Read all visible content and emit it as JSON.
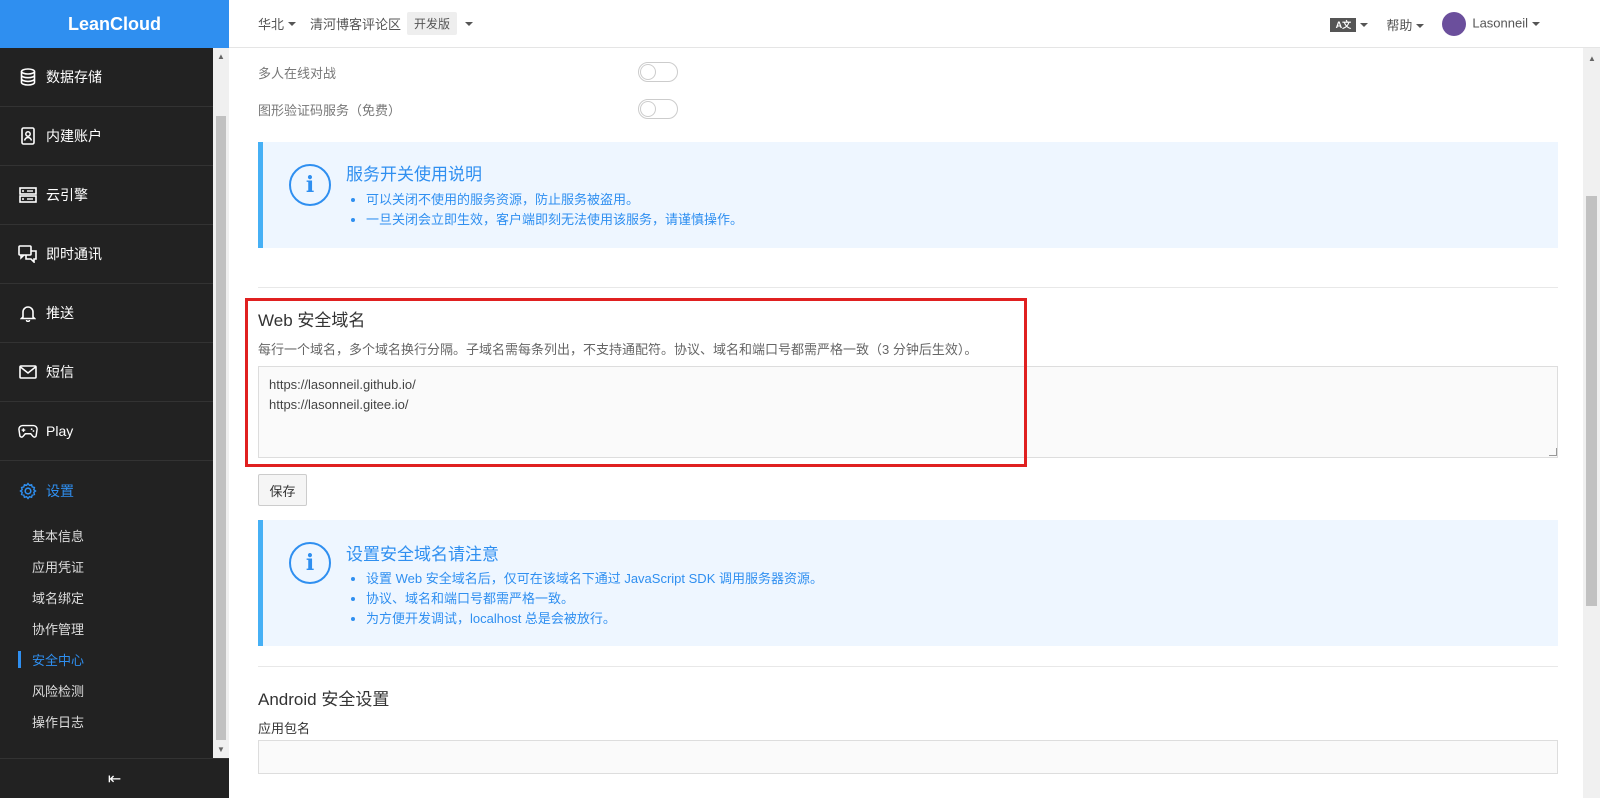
{
  "app": {
    "logo": "LeanCloud"
  },
  "sidebar": {
    "items": [
      {
        "label": "数据存储",
        "icon": "database-icon"
      },
      {
        "label": "内建账户",
        "icon": "account-book-icon"
      },
      {
        "label": "云引擎",
        "icon": "server-icon"
      },
      {
        "label": "即时通讯",
        "icon": "chat-icon"
      },
      {
        "label": "推送",
        "icon": "bell-icon"
      },
      {
        "label": "短信",
        "icon": "mail-icon"
      },
      {
        "label": "Play",
        "icon": "gamepad-icon"
      },
      {
        "label": "设置",
        "icon": "gear-icon"
      }
    ],
    "sub_items": [
      {
        "label": "基本信息"
      },
      {
        "label": "应用凭证"
      },
      {
        "label": "域名绑定"
      },
      {
        "label": "协作管理"
      },
      {
        "label": "安全中心"
      },
      {
        "label": "风险检测"
      },
      {
        "label": "操作日志"
      }
    ],
    "collapse_icon": "collapse-left-icon",
    "collapse_glyph": "⇤"
  },
  "topbar": {
    "region": "华北",
    "app_name": "清河博客评论区",
    "plan": "开发版",
    "lang_icon_text": "A文",
    "help": "帮助",
    "user": "Lasonneil"
  },
  "services": {
    "multiplayer_label": "多人在线对战",
    "captcha_label": "图形验证码服务（免费）"
  },
  "notice_services": {
    "title": "服务开关使用说明",
    "items": [
      "可以关闭不使用的服务资源，防止服务被盗用。",
      "一旦关闭会立即生效，客户端即刻无法使用该服务，请谨慎操作。"
    ]
  },
  "web_domain": {
    "title": "Web 安全域名",
    "description": "每行一个域名，多个域名换行分隔。子域名需每条列出，不支持通配符。协议、域名和端口号都需严格一致（3 分钟后生效）。",
    "value": "https://lasonneil.github.io/\nhttps://lasonneil.gitee.io/",
    "save_label": "保存"
  },
  "notice_domain": {
    "title": "设置安全域名请注意",
    "items": [
      "设置 Web 安全域名后，仅可在该域名下通过 JavaScript SDK 调用服务器资源。",
      "协议、域名和端口号都需严格一致。",
      "为方便开发调试，localhost 总是会被放行。"
    ]
  },
  "android": {
    "title": "Android 安全设置",
    "package_label": "应用包名"
  },
  "colors": {
    "accent": "#2f8ff0",
    "sidebar_bg": "#222222",
    "highlight": "#e02020",
    "notice_bg": "#eef6ff"
  }
}
